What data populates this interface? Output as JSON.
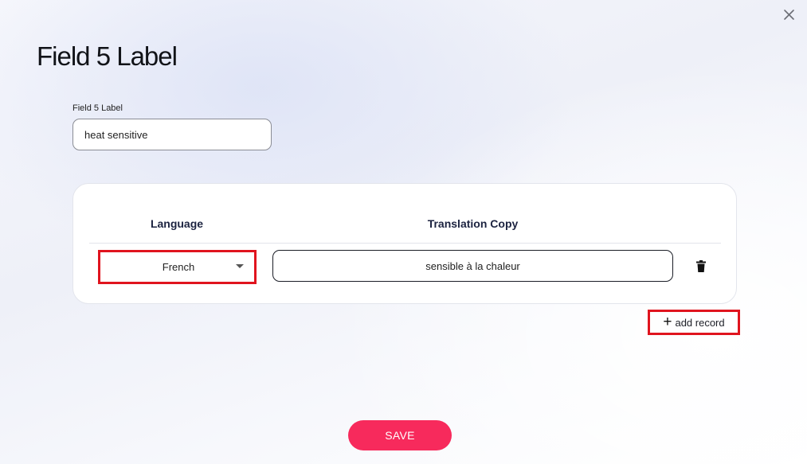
{
  "dialog": {
    "title": "Field 5 Label",
    "close_icon": "close-icon"
  },
  "label_field": {
    "label": "Field 5 Label",
    "value": "heat sensitive"
  },
  "translations": {
    "columns": [
      "Language",
      "Translation Copy"
    ],
    "rows": [
      {
        "language": "French",
        "translation": "sensible à la chaleur",
        "delete_icon": "trash-icon"
      }
    ]
  },
  "add_record": {
    "icon": "plus-icon",
    "label": "add record"
  },
  "save": {
    "label": "SAVE"
  },
  "colors": {
    "accent": "#f72a5c",
    "highlight": "#e0141e",
    "heading": "#1c2340"
  }
}
